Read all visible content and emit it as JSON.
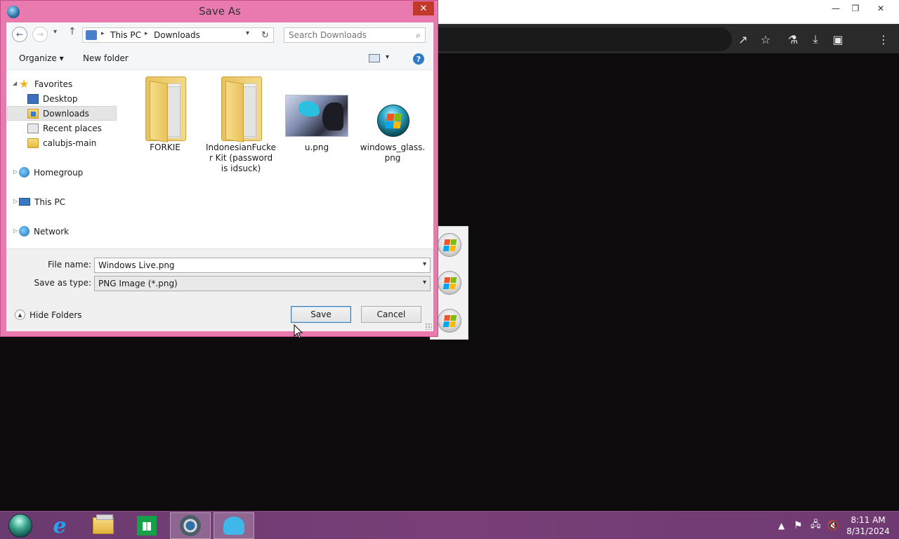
{
  "browser": {
    "window_controls": {
      "minimize": "—",
      "restore": "❐",
      "close": "✕"
    },
    "toolbar_icons": [
      "share-icon",
      "star-icon",
      "labs-icon",
      "download-icon",
      "sidepanel-icon",
      "profile-icon",
      "menu-icon"
    ]
  },
  "dialog": {
    "title": "Save As",
    "address": {
      "crumbs": [
        "This PC",
        "Downloads"
      ]
    },
    "search": {
      "placeholder": "Search Downloads"
    },
    "commands": {
      "organize": "Organize",
      "new_folder": "New folder"
    },
    "nav_tree": {
      "favorites": "Favorites",
      "desktop": "Desktop",
      "downloads": "Downloads",
      "recent_places": "Recent places",
      "calubjs_main": "calubjs-main",
      "homegroup": "Homegroup",
      "this_pc": "This PC",
      "network": "Network"
    },
    "files": [
      {
        "name": "FORKIE",
        "kind": "folder"
      },
      {
        "name": "IndonesianFucker Kit (password is idsuck)",
        "kind": "folder"
      },
      {
        "name": "u.png",
        "kind": "image"
      },
      {
        "name": "windows_glass.png",
        "kind": "image"
      }
    ],
    "file_name_label": "File name:",
    "file_name_value": "Windows Live.png",
    "save_type_label": "Save as type:",
    "save_type_value": "PNG Image (*.png)",
    "hide_folders": "Hide Folders",
    "save_button": "Save",
    "cancel_button": "Cancel"
  },
  "taskbar": {
    "clock_time": "8:11 AM",
    "clock_date": "8/31/2024",
    "apps": [
      "start-orb",
      "internet-explorer",
      "file-explorer",
      "store",
      "chrome",
      "shell"
    ]
  },
  "colors": {
    "dialog_frame": "#e97ab0",
    "taskbar": "#7a3f78"
  }
}
